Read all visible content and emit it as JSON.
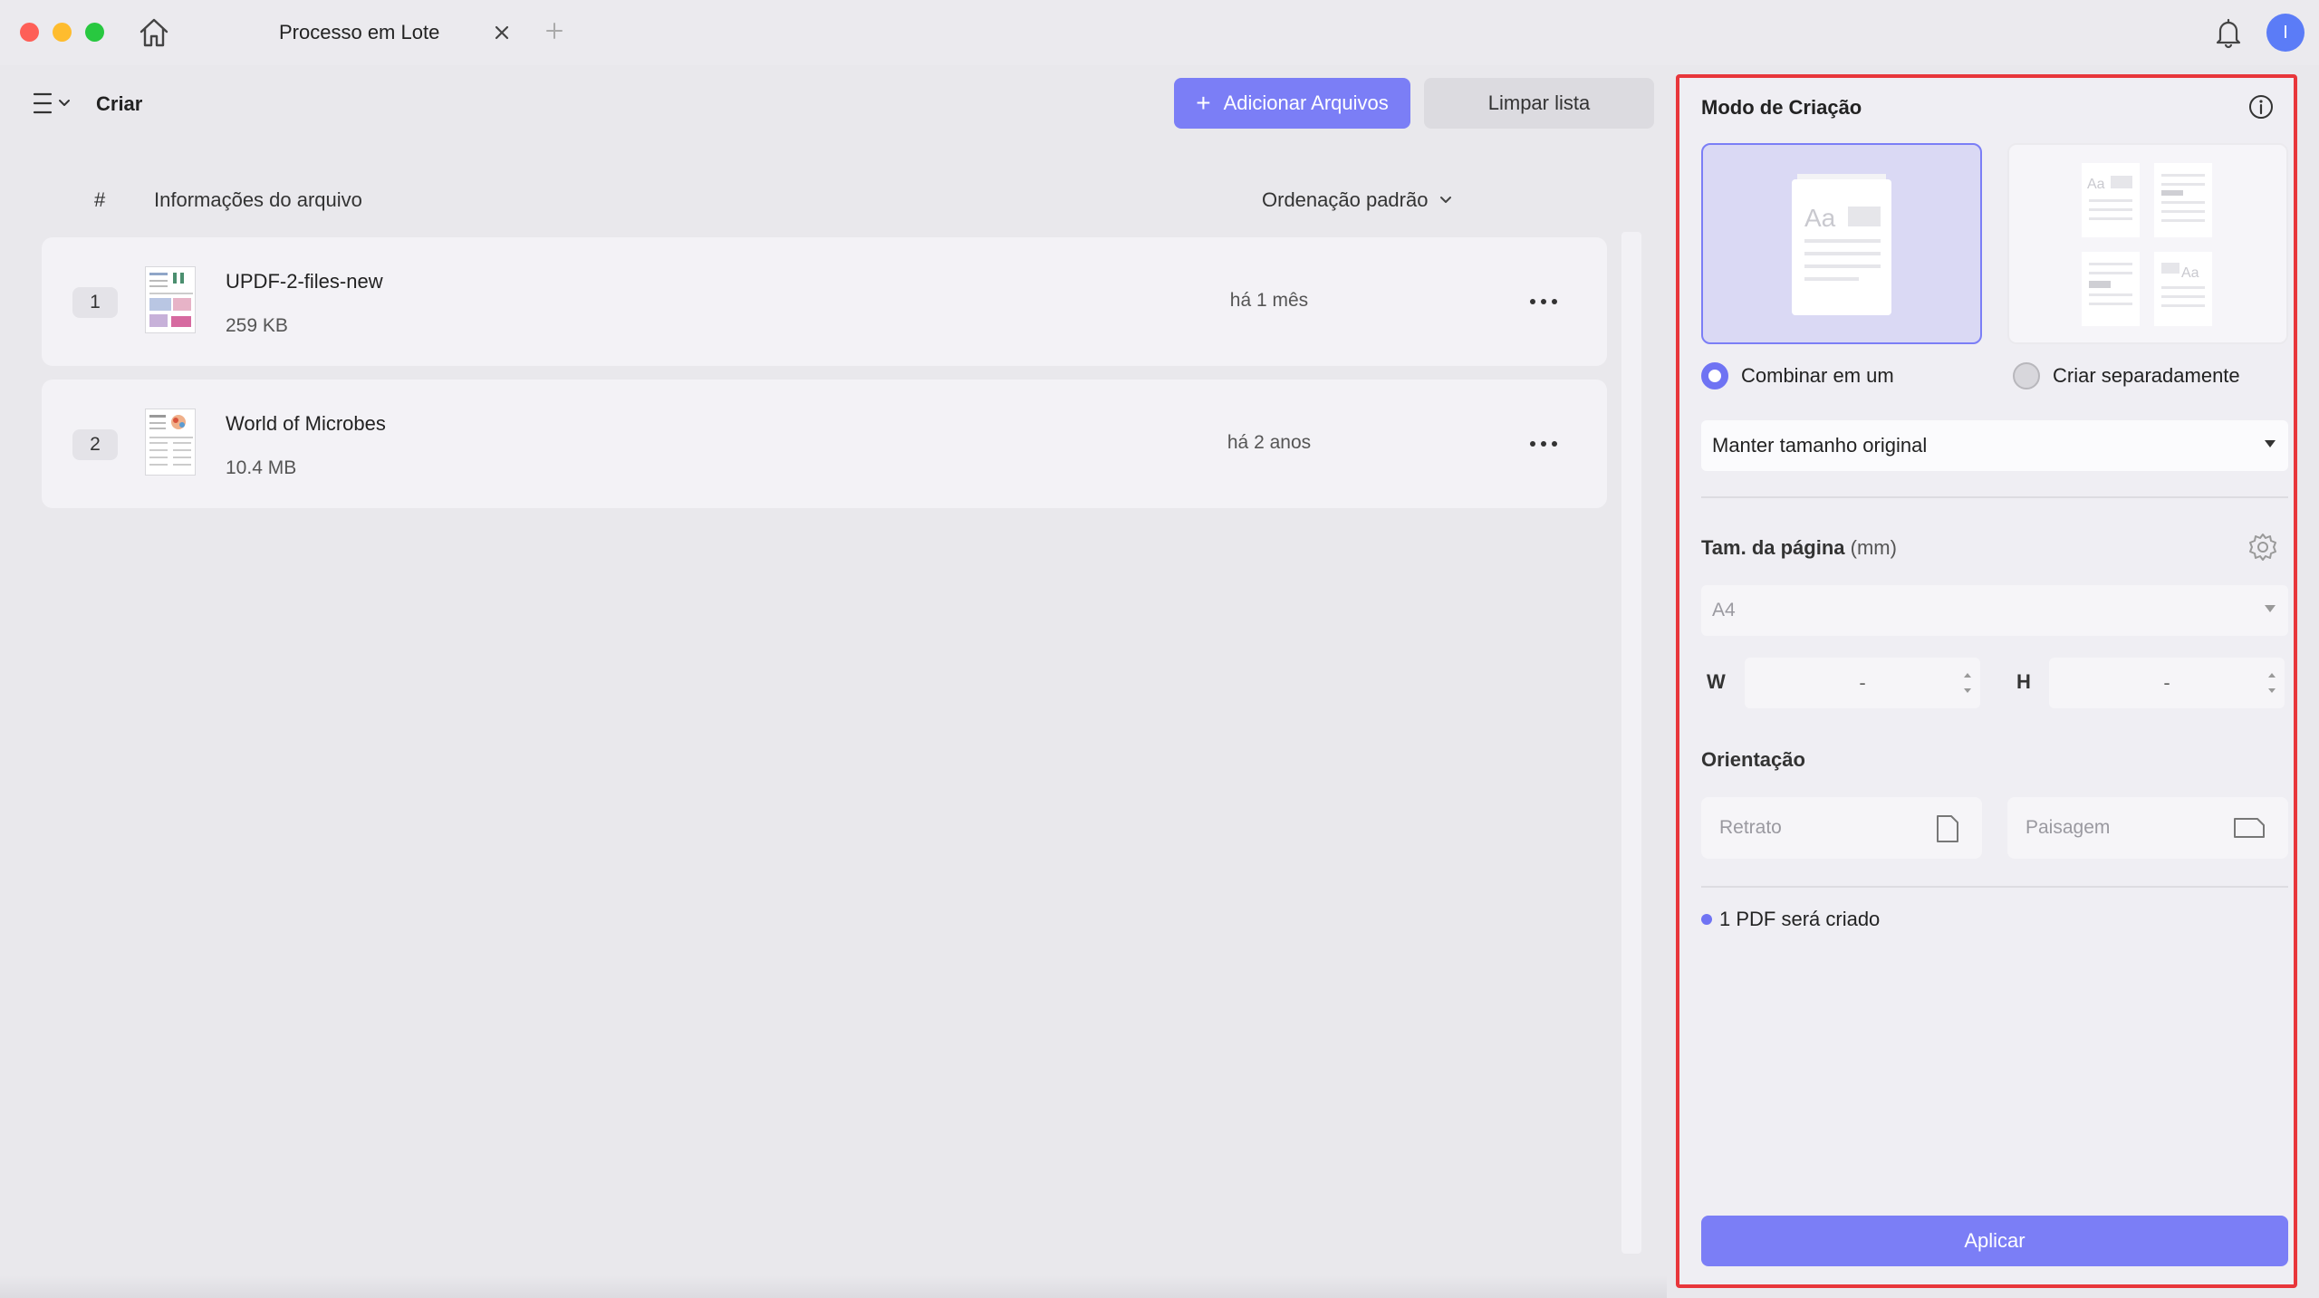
{
  "window": {
    "tab_title": "Processo em Lote",
    "avatar_initial": "I"
  },
  "toolbar": {
    "title": "Criar",
    "add_files_label": "Adicionar Arquivos",
    "clear_list_label": "Limpar lista"
  },
  "list": {
    "col_index": "#",
    "col_info": "Informações do arquivo",
    "sort_label": "Ordenação padrão",
    "files": [
      {
        "index": "1",
        "name": "UPDF-2-files-new",
        "size": "259 KB",
        "date": "há 1 mês"
      },
      {
        "index": "2",
        "name": "World of Microbes",
        "size": "10.4 MB",
        "date": "há 2 anos"
      }
    ]
  },
  "panel": {
    "title": "Modo de Criação",
    "combine_label": "Combinar em um",
    "separate_label": "Criar separadamente",
    "selected_mode": "combine",
    "size_option": "Manter tamanho original",
    "page_size_label": "Tam. da página",
    "page_size_unit": "(mm)",
    "paper": "A4",
    "width_label": "W",
    "height_label": "H",
    "width_value": "-",
    "height_value": "-",
    "orientation_label": "Orientação",
    "portrait_label": "Retrato",
    "landscape_label": "Paisagem",
    "status_text": "1 PDF será criado",
    "apply_label": "Aplicar"
  },
  "colors": {
    "accent": "#7b7ef6",
    "highlight_border": "#e8363b"
  }
}
